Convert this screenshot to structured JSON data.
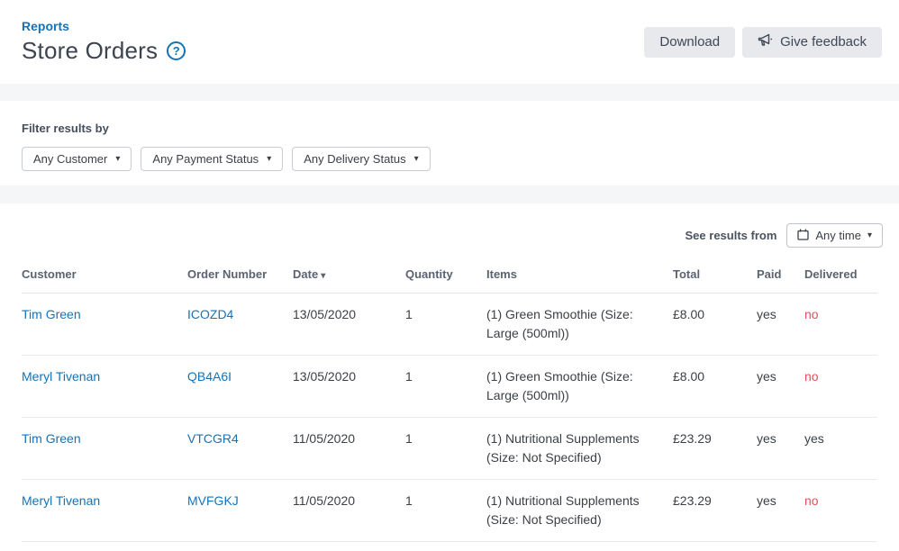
{
  "breadcrumb": {
    "label": "Reports"
  },
  "page": {
    "title": "Store Orders"
  },
  "actions": {
    "download": "Download",
    "feedback": "Give feedback"
  },
  "filters": {
    "label": "Filter results by",
    "customer": "Any Customer",
    "payment": "Any Payment Status",
    "delivery": "Any Delivery Status"
  },
  "results_bar": {
    "label": "See results from",
    "time": "Any time"
  },
  "table": {
    "headers": {
      "customer": "Customer",
      "order": "Order Number",
      "date": "Date",
      "quantity": "Quantity",
      "items": "Items",
      "total": "Total",
      "paid": "Paid",
      "delivered": "Delivered"
    },
    "rows": [
      {
        "customer": "Tim Green",
        "order": "ICOZD4",
        "date": "13/05/2020",
        "quantity": "1",
        "items": "(1) Green Smoothie (Size: Large (500ml))",
        "total": "£8.00",
        "paid": "yes",
        "delivered": "no"
      },
      {
        "customer": "Meryl Tivenan",
        "order": "QB4A6I",
        "date": "13/05/2020",
        "quantity": "1",
        "items": "(1) Green Smoothie (Size: Large (500ml))",
        "total": "£8.00",
        "paid": "yes",
        "delivered": "no"
      },
      {
        "customer": "Tim Green",
        "order": "VTCGR4",
        "date": "11/05/2020",
        "quantity": "1",
        "items": "(1) Nutritional Supplements (Size: Not Specified)",
        "total": "£23.29",
        "paid": "yes",
        "delivered": "yes"
      },
      {
        "customer": "Meryl Tivenan",
        "order": "MVFGKJ",
        "date": "11/05/2020",
        "quantity": "1",
        "items": "(1) Nutritional Supplements (Size: Not Specified)",
        "total": "£23.29",
        "paid": "yes",
        "delivered": "no"
      }
    ]
  },
  "icons": {
    "help": "?",
    "caret": "▾"
  },
  "colors": {
    "link": "#1373b9",
    "negative": "#e0505e"
  }
}
